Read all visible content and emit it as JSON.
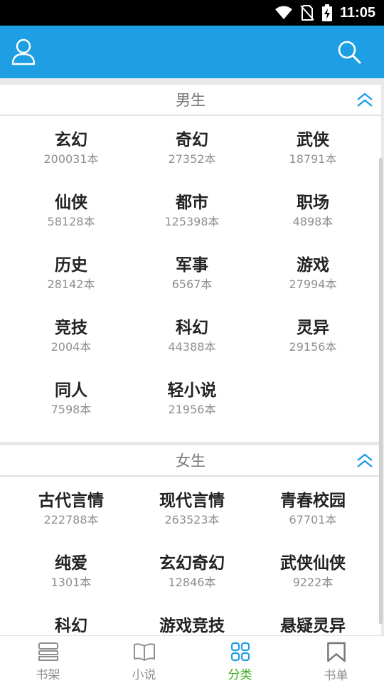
{
  "status_bar": {
    "time": "11:05"
  },
  "header": {
    "profile_icon": "person-icon",
    "search_icon": "search-icon"
  },
  "sections": [
    {
      "title": "男生",
      "categories": [
        {
          "name": "玄幻",
          "count": "200031本"
        },
        {
          "name": "奇幻",
          "count": "27352本"
        },
        {
          "name": "武侠",
          "count": "18791本"
        },
        {
          "name": "仙侠",
          "count": "58128本"
        },
        {
          "name": "都市",
          "count": "125398本"
        },
        {
          "name": "职场",
          "count": "4898本"
        },
        {
          "name": "历史",
          "count": "28142本"
        },
        {
          "name": "军事",
          "count": "6567本"
        },
        {
          "name": "游戏",
          "count": "27994本"
        },
        {
          "name": "竞技",
          "count": "2004本"
        },
        {
          "name": "科幻",
          "count": "44388本"
        },
        {
          "name": "灵异",
          "count": "29156本"
        },
        {
          "name": "同人",
          "count": "7598本"
        },
        {
          "name": "轻小说",
          "count": "21956本"
        }
      ]
    },
    {
      "title": "女生",
      "categories": [
        {
          "name": "古代言情",
          "count": "222788本"
        },
        {
          "name": "现代言情",
          "count": "263523本"
        },
        {
          "name": "青春校园",
          "count": "67701本"
        },
        {
          "name": "纯爱",
          "count": "1301本"
        },
        {
          "name": "玄幻奇幻",
          "count": "12846本"
        },
        {
          "name": "武侠仙侠",
          "count": "9222本"
        },
        {
          "name": "科幻",
          "count": ""
        },
        {
          "name": "游戏竞技",
          "count": ""
        },
        {
          "name": "悬疑灵异",
          "count": ""
        }
      ]
    }
  ],
  "bottom_nav": [
    {
      "label": "书架",
      "icon": "bookshelf-icon",
      "active": false
    },
    {
      "label": "小说",
      "icon": "open-book-icon",
      "active": false
    },
    {
      "label": "分类",
      "icon": "category-grid-icon",
      "active": true
    },
    {
      "label": "书单",
      "icon": "bookmark-icon",
      "active": false
    }
  ],
  "colors": {
    "primary": "#1e9ee3",
    "active_tab": "#3cae20",
    "count_text": "#8f8f8f"
  }
}
